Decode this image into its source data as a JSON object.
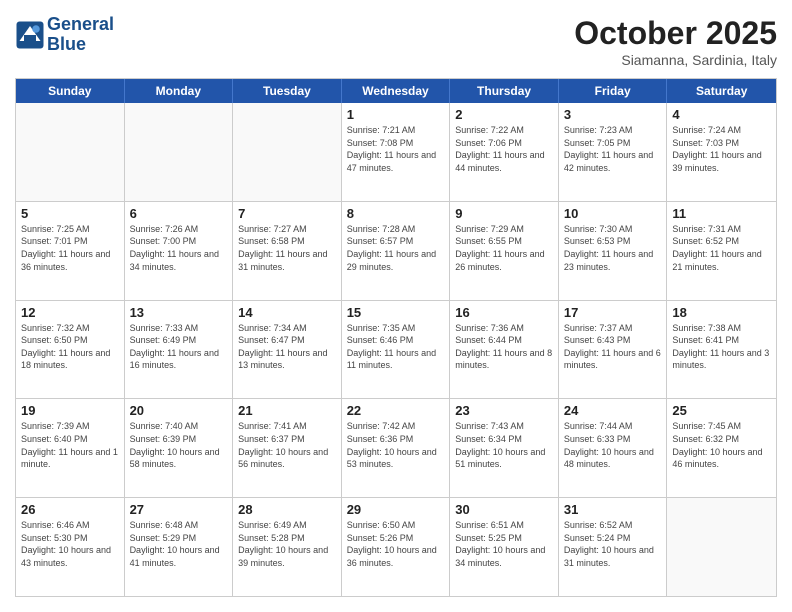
{
  "header": {
    "logo_line1": "General",
    "logo_line2": "Blue",
    "month": "October 2025",
    "location": "Siamanna, Sardinia, Italy"
  },
  "weekdays": [
    "Sunday",
    "Monday",
    "Tuesday",
    "Wednesday",
    "Thursday",
    "Friday",
    "Saturday"
  ],
  "rows": [
    [
      {
        "day": "",
        "info": ""
      },
      {
        "day": "",
        "info": ""
      },
      {
        "day": "",
        "info": ""
      },
      {
        "day": "1",
        "info": "Sunrise: 7:21 AM\nSunset: 7:08 PM\nDaylight: 11 hours and 47 minutes."
      },
      {
        "day": "2",
        "info": "Sunrise: 7:22 AM\nSunset: 7:06 PM\nDaylight: 11 hours and 44 minutes."
      },
      {
        "day": "3",
        "info": "Sunrise: 7:23 AM\nSunset: 7:05 PM\nDaylight: 11 hours and 42 minutes."
      },
      {
        "day": "4",
        "info": "Sunrise: 7:24 AM\nSunset: 7:03 PM\nDaylight: 11 hours and 39 minutes."
      }
    ],
    [
      {
        "day": "5",
        "info": "Sunrise: 7:25 AM\nSunset: 7:01 PM\nDaylight: 11 hours and 36 minutes."
      },
      {
        "day": "6",
        "info": "Sunrise: 7:26 AM\nSunset: 7:00 PM\nDaylight: 11 hours and 34 minutes."
      },
      {
        "day": "7",
        "info": "Sunrise: 7:27 AM\nSunset: 6:58 PM\nDaylight: 11 hours and 31 minutes."
      },
      {
        "day": "8",
        "info": "Sunrise: 7:28 AM\nSunset: 6:57 PM\nDaylight: 11 hours and 29 minutes."
      },
      {
        "day": "9",
        "info": "Sunrise: 7:29 AM\nSunset: 6:55 PM\nDaylight: 11 hours and 26 minutes."
      },
      {
        "day": "10",
        "info": "Sunrise: 7:30 AM\nSunset: 6:53 PM\nDaylight: 11 hours and 23 minutes."
      },
      {
        "day": "11",
        "info": "Sunrise: 7:31 AM\nSunset: 6:52 PM\nDaylight: 11 hours and 21 minutes."
      }
    ],
    [
      {
        "day": "12",
        "info": "Sunrise: 7:32 AM\nSunset: 6:50 PM\nDaylight: 11 hours and 18 minutes."
      },
      {
        "day": "13",
        "info": "Sunrise: 7:33 AM\nSunset: 6:49 PM\nDaylight: 11 hours and 16 minutes."
      },
      {
        "day": "14",
        "info": "Sunrise: 7:34 AM\nSunset: 6:47 PM\nDaylight: 11 hours and 13 minutes."
      },
      {
        "day": "15",
        "info": "Sunrise: 7:35 AM\nSunset: 6:46 PM\nDaylight: 11 hours and 11 minutes."
      },
      {
        "day": "16",
        "info": "Sunrise: 7:36 AM\nSunset: 6:44 PM\nDaylight: 11 hours and 8 minutes."
      },
      {
        "day": "17",
        "info": "Sunrise: 7:37 AM\nSunset: 6:43 PM\nDaylight: 11 hours and 6 minutes."
      },
      {
        "day": "18",
        "info": "Sunrise: 7:38 AM\nSunset: 6:41 PM\nDaylight: 11 hours and 3 minutes."
      }
    ],
    [
      {
        "day": "19",
        "info": "Sunrise: 7:39 AM\nSunset: 6:40 PM\nDaylight: 11 hours and 1 minute."
      },
      {
        "day": "20",
        "info": "Sunrise: 7:40 AM\nSunset: 6:39 PM\nDaylight: 10 hours and 58 minutes."
      },
      {
        "day": "21",
        "info": "Sunrise: 7:41 AM\nSunset: 6:37 PM\nDaylight: 10 hours and 56 minutes."
      },
      {
        "day": "22",
        "info": "Sunrise: 7:42 AM\nSunset: 6:36 PM\nDaylight: 10 hours and 53 minutes."
      },
      {
        "day": "23",
        "info": "Sunrise: 7:43 AM\nSunset: 6:34 PM\nDaylight: 10 hours and 51 minutes."
      },
      {
        "day": "24",
        "info": "Sunrise: 7:44 AM\nSunset: 6:33 PM\nDaylight: 10 hours and 48 minutes."
      },
      {
        "day": "25",
        "info": "Sunrise: 7:45 AM\nSunset: 6:32 PM\nDaylight: 10 hours and 46 minutes."
      }
    ],
    [
      {
        "day": "26",
        "info": "Sunrise: 6:46 AM\nSunset: 5:30 PM\nDaylight: 10 hours and 43 minutes."
      },
      {
        "day": "27",
        "info": "Sunrise: 6:48 AM\nSunset: 5:29 PM\nDaylight: 10 hours and 41 minutes."
      },
      {
        "day": "28",
        "info": "Sunrise: 6:49 AM\nSunset: 5:28 PM\nDaylight: 10 hours and 39 minutes."
      },
      {
        "day": "29",
        "info": "Sunrise: 6:50 AM\nSunset: 5:26 PM\nDaylight: 10 hours and 36 minutes."
      },
      {
        "day": "30",
        "info": "Sunrise: 6:51 AM\nSunset: 5:25 PM\nDaylight: 10 hours and 34 minutes."
      },
      {
        "day": "31",
        "info": "Sunrise: 6:52 AM\nSunset: 5:24 PM\nDaylight: 10 hours and 31 minutes."
      },
      {
        "day": "",
        "info": ""
      }
    ]
  ]
}
